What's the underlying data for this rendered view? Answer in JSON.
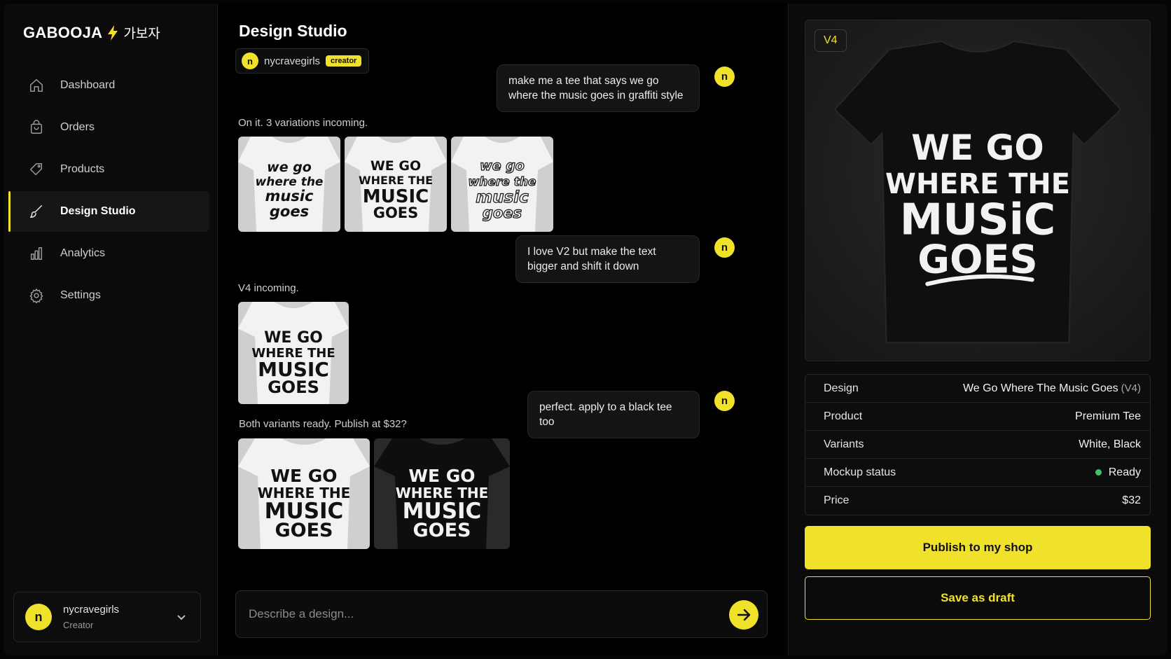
{
  "brand": {
    "name": "GABOOJA",
    "korean": "가보자",
    "accent": "#f0e12b"
  },
  "sidebar": {
    "items": [
      {
        "label": "Dashboard",
        "icon": "home-icon"
      },
      {
        "label": "Orders",
        "icon": "bag-icon"
      },
      {
        "label": "Products",
        "icon": "tag-icon"
      },
      {
        "label": "Design Studio",
        "icon": "brush-icon",
        "active": true
      },
      {
        "label": "Analytics",
        "icon": "bar-chart-icon"
      },
      {
        "label": "Settings",
        "icon": "gear-icon"
      }
    ],
    "user": {
      "initial": "n",
      "name": "nycravegirls",
      "role": "Creator"
    }
  },
  "chat": {
    "title": "Design Studio",
    "creator": {
      "initial": "n",
      "name": "nycravegirls",
      "badge": "creator"
    },
    "messages": [
      {
        "from": "user",
        "initial": "n",
        "text": "make me a tee that says we go where the music goes in graffiti style"
      },
      {
        "from": "bot",
        "text": "On it. 3 variations incoming.",
        "images": [
          "white tee graffiti variation 1",
          "white tee graffiti variation 2",
          "white tee graffiti variation 3"
        ]
      },
      {
        "from": "user",
        "initial": "n",
        "text": "I love V2 but make the text bigger and shift it down"
      },
      {
        "from": "bot",
        "text": "V4 incoming.",
        "images": [
          "white tee V4"
        ]
      },
      {
        "from": "user",
        "initial": "n",
        "text": "perfect. apply to a black tee too"
      },
      {
        "from": "bot",
        "text": "Both variants ready. Publish at $32?",
        "images": [
          "white tee V4",
          "black tee V4"
        ]
      }
    ],
    "composer": {
      "placeholder": "Describe a design...",
      "send_icon": "arrow-right-icon"
    }
  },
  "preview": {
    "version_badge": "V4",
    "tee_color": "#111111",
    "design_lines": [
      "WE GO",
      "WHERE THE",
      "MUSiC",
      "GOES"
    ]
  },
  "details": {
    "rows": [
      {
        "key": "Design",
        "value": "We Go Where The Music Goes",
        "sub": "(V4)"
      },
      {
        "key": "Product",
        "value": "Premium Tee"
      },
      {
        "key": "Variants",
        "value": "White, Black"
      },
      {
        "key": "Mockup status",
        "value": "Ready",
        "status_color": "#3fc26a"
      },
      {
        "key": "Price",
        "value": "$32"
      }
    ]
  },
  "actions": {
    "publish": "Publish to my shop",
    "draft": "Save as draft"
  }
}
